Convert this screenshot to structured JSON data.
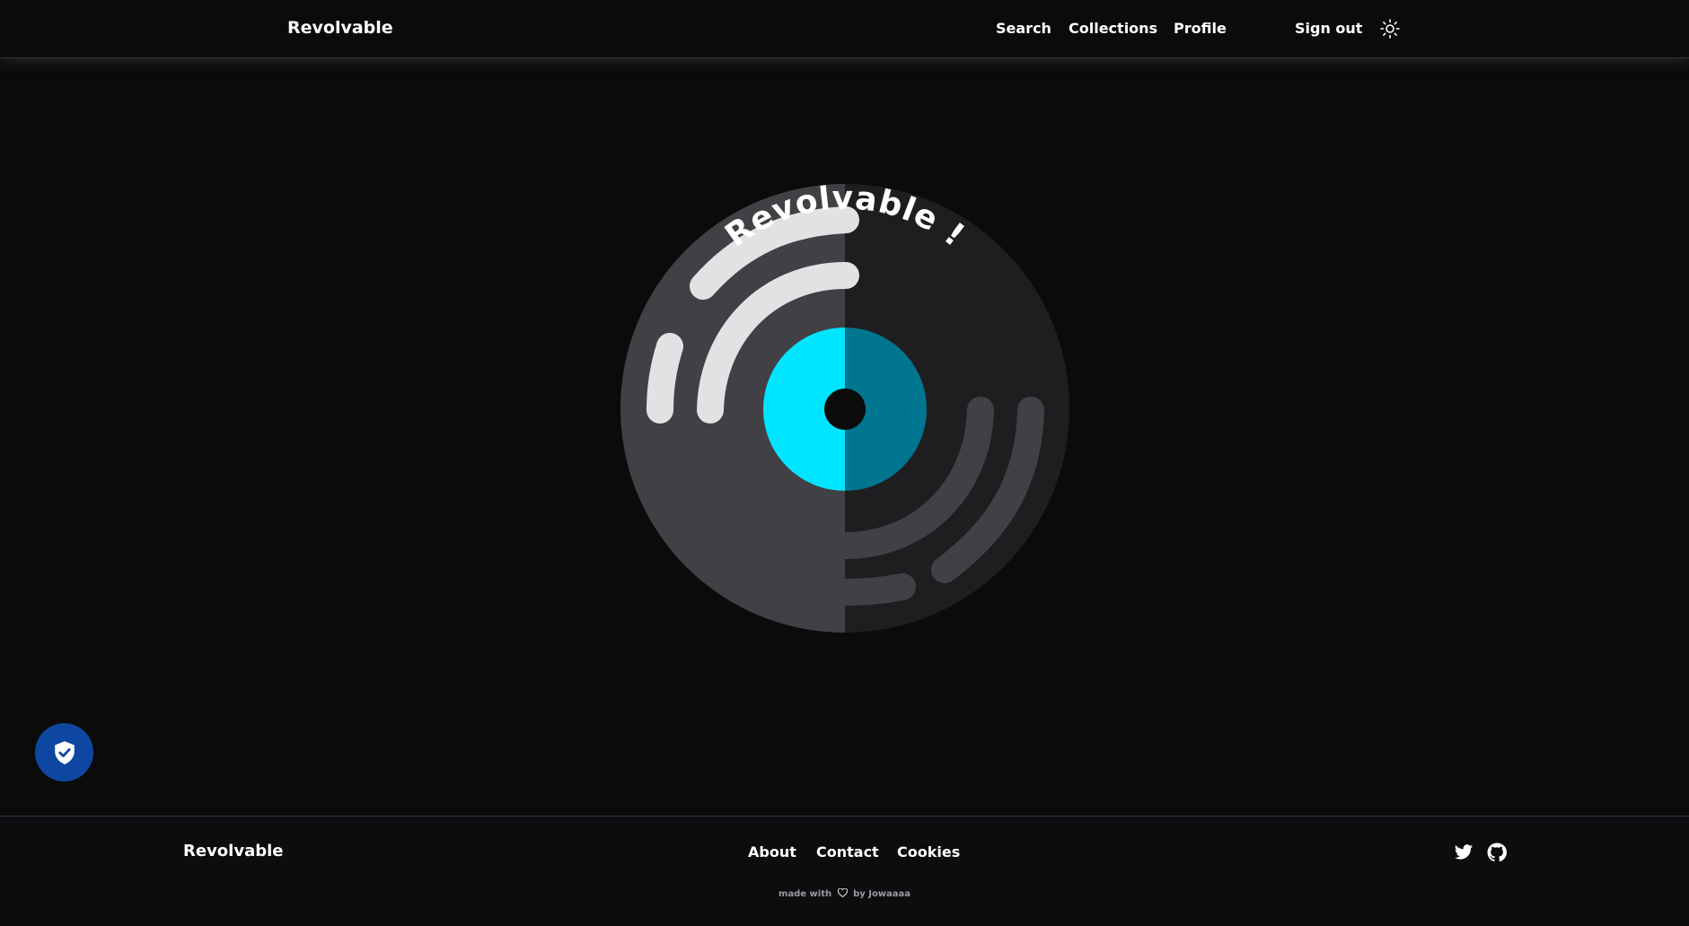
{
  "header": {
    "brand": "Revolvable",
    "nav": {
      "search": "Search",
      "collections": "Collections",
      "profile": "Profile",
      "sign_out": "Sign out"
    },
    "theme_icon": "sun-icon"
  },
  "hero": {
    "arc_text": "Revolvable !",
    "colors": {
      "disc_left": "#414145",
      "disc_right": "#1e1e20",
      "label_left": "#00e5ff",
      "label_right": "#00758f",
      "grooves_light": "#e2e2e4",
      "grooves_dark": "#414145"
    }
  },
  "privacy_button": {
    "icon": "shield-check-icon",
    "color": "#0d47a1"
  },
  "footer": {
    "brand": "Revolvable",
    "links": {
      "about": "About",
      "contact": "Contact",
      "cookies": "Cookies"
    },
    "social": [
      "twitter-icon",
      "github-icon"
    ],
    "credit": {
      "prefix": "made with",
      "suffix": "by Jowaaaa"
    }
  }
}
